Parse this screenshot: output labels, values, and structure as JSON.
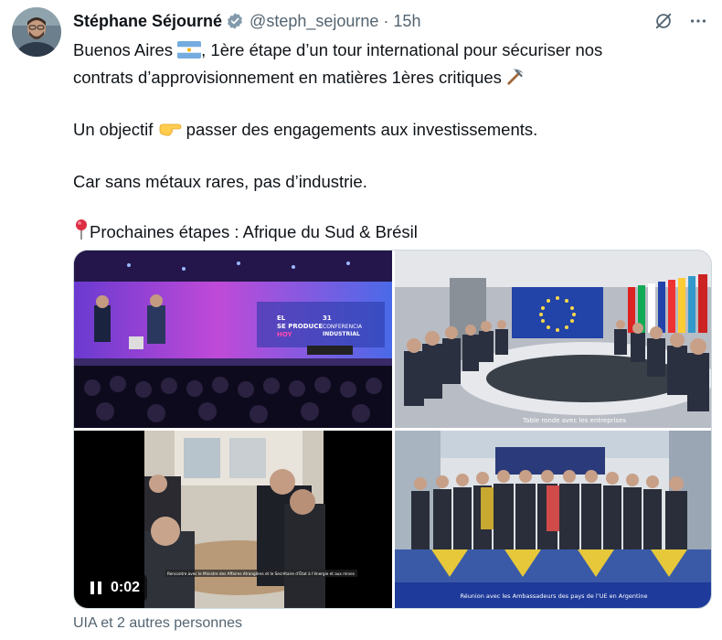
{
  "author": {
    "name": "Stéphane Séjourné",
    "handle": "@steph_sejourne",
    "time": "15h"
  },
  "icons": [
    "verified-badge-icon",
    "grok-icon",
    "more-icon",
    "argentina-flag-icon",
    "pickaxe-icon",
    "backhand-index-pointing-right-icon",
    "round-pushpin-icon",
    "pause-icon"
  ],
  "tweet": {
    "line1": "Buenos Aires",
    "line1_rest": ", 1ère étape d’un tour international pour sécuriser nos",
    "line2": "contrats d’approvisionnement en matières 1ères critiques",
    "para2_a": "Un objectif",
    "para2_b": " passer des engagements aux investissements.",
    "para3": "Car sans métaux rares, pas d’industrie.",
    "para4": "Prochaines étapes : Afrique du Sud & Brésil"
  },
  "media": {
    "photo1": {
      "screen_line1": "EL",
      "screen_line2": "SE PRODUCE",
      "screen_line3": "HOY",
      "screen_num": "31",
      "screen_conf1": "CONFERENCIA",
      "screen_conf2": "INDUSTRIAL"
    },
    "photo2": {
      "caption": "Table ronde avec les entreprises"
    },
    "video": {
      "duration": "0:02",
      "subtitle": "Rencontre avec le Ministre des Affaires étrangères et le Secrétaire d’État à l’énergie et aux mines"
    },
    "photo4": {
      "caption": "Réunion avec les Ambassadeurs des pays de l’UE en Argentine"
    }
  },
  "footer": {
    "likes_text": "UIA et 2 autres personnes"
  },
  "colors": {
    "accent": "#1d9bf0",
    "secondary_text": "#536471",
    "border": "#cfd9de"
  }
}
